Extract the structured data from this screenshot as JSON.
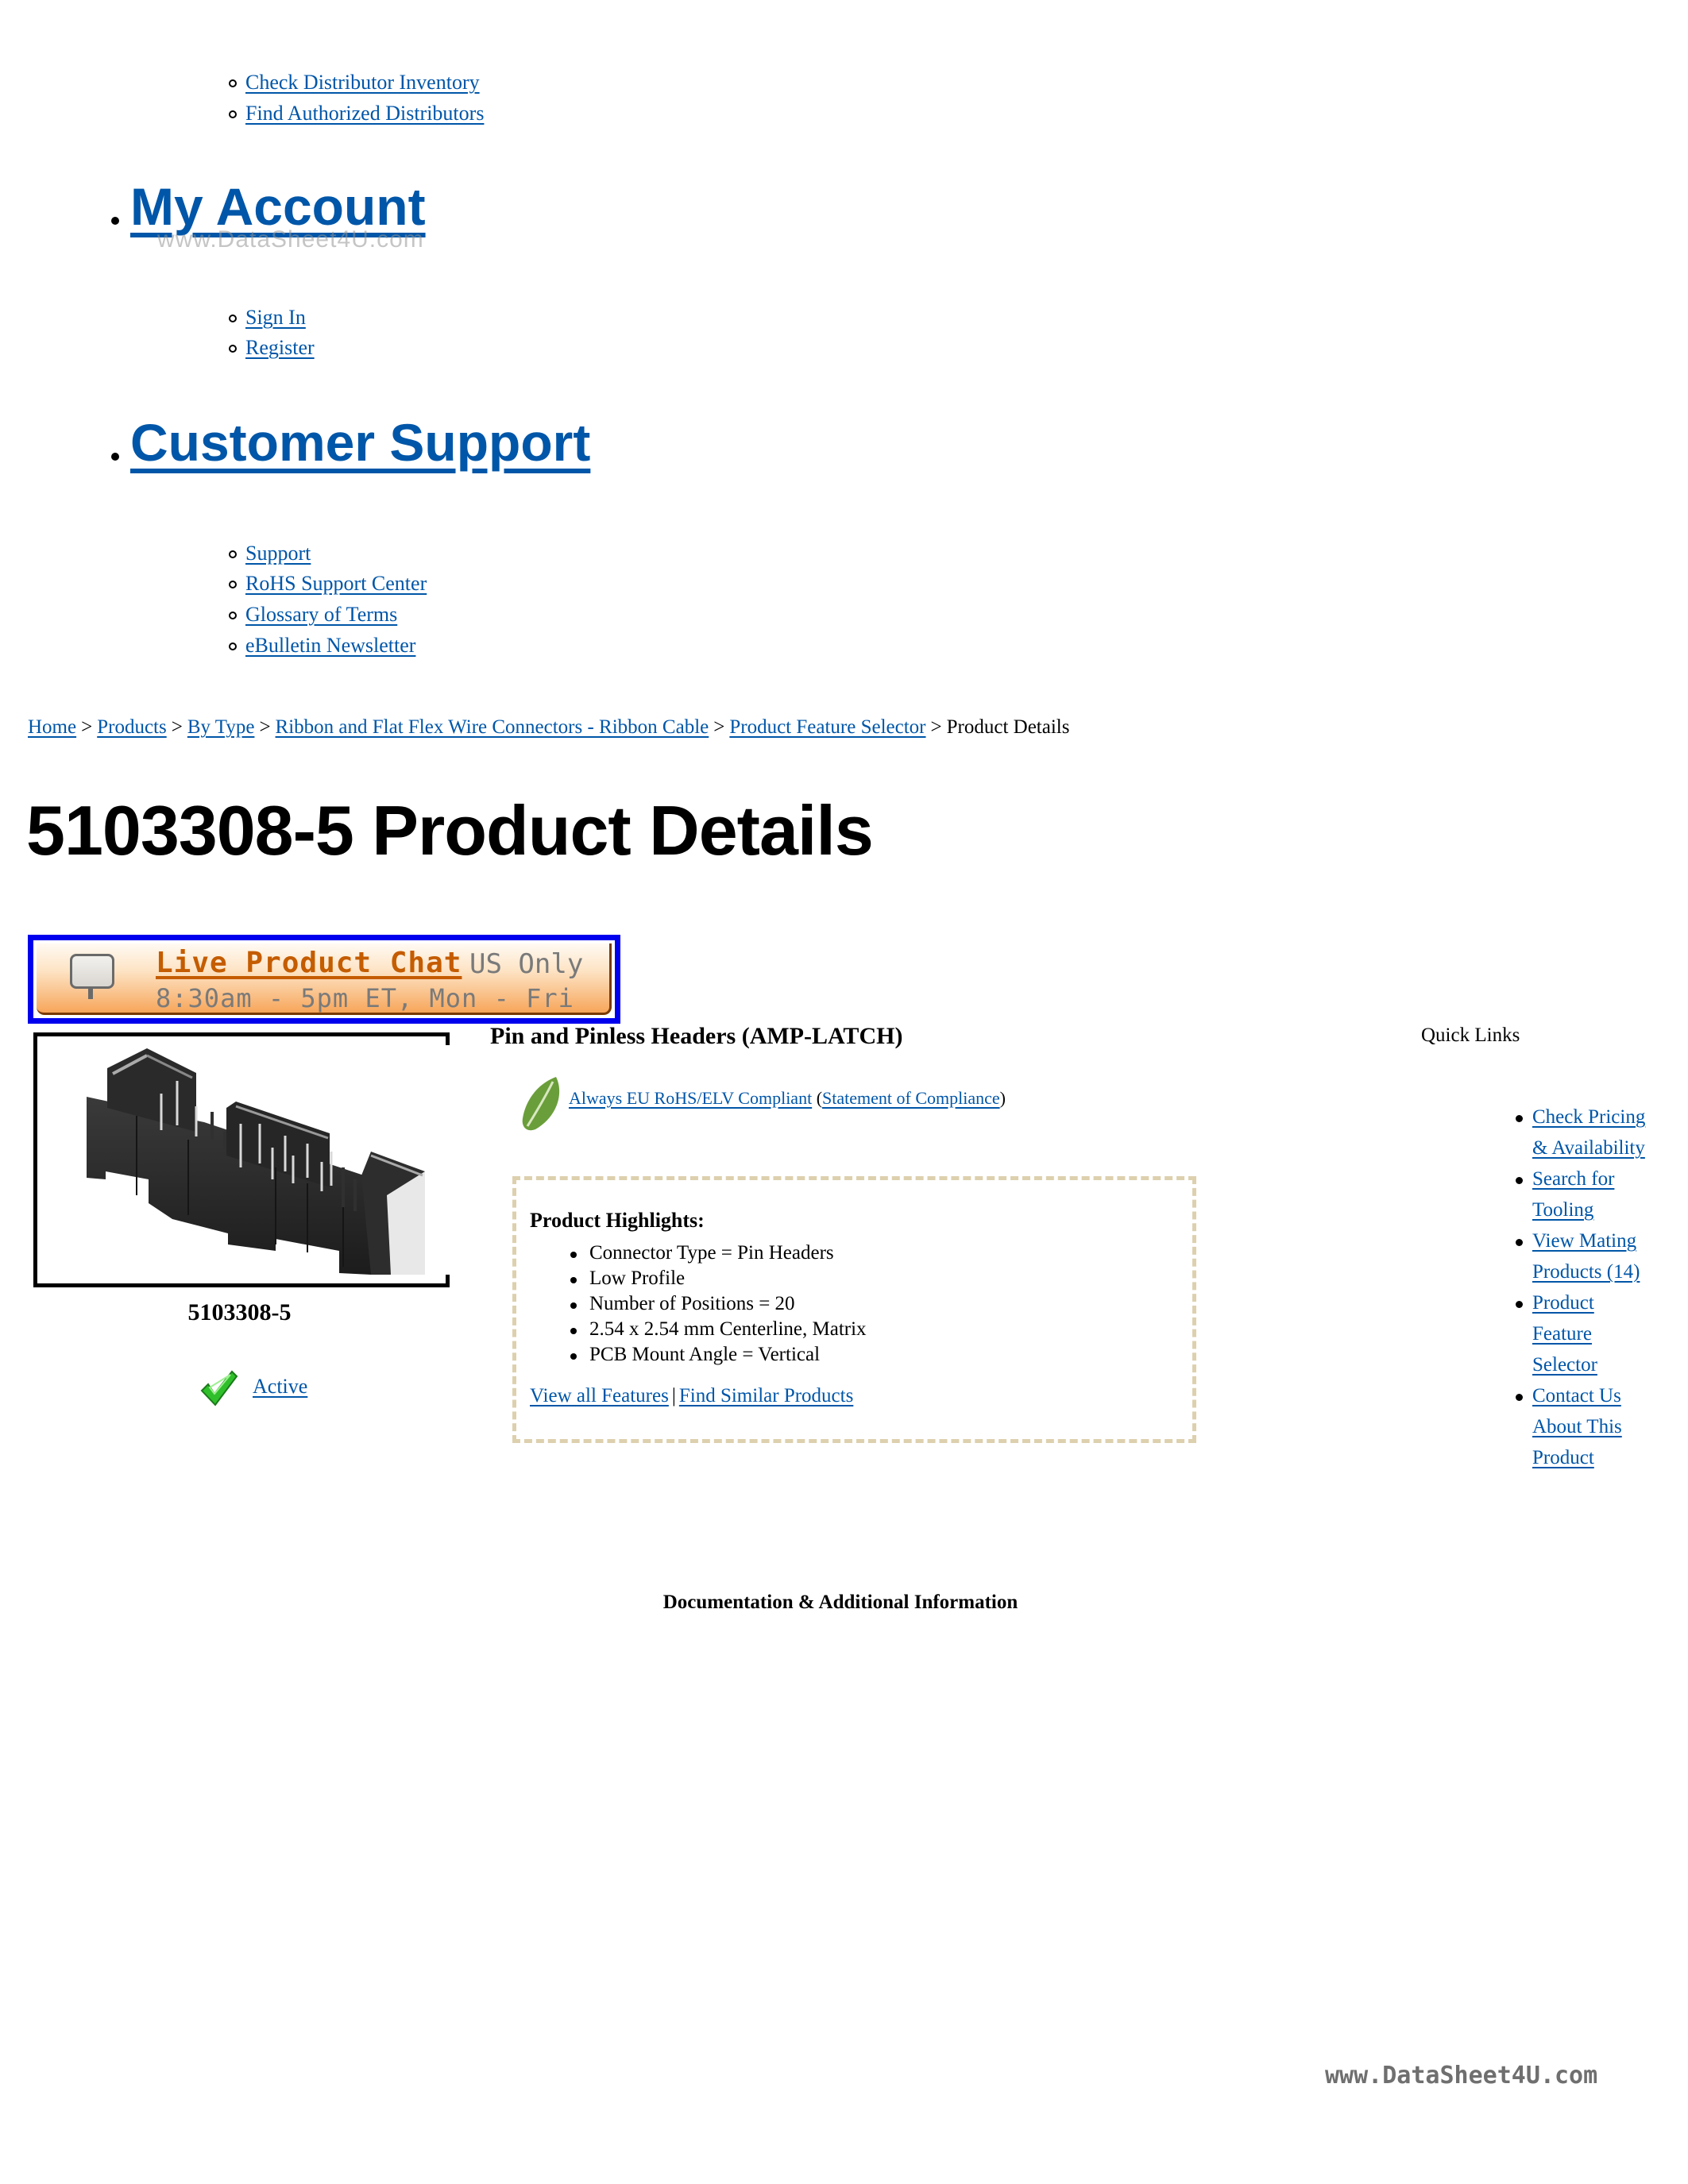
{
  "distributor_links": [
    {
      "label": "Check Distributor Inventory"
    },
    {
      "label": "Find Authorized Distributors"
    }
  ],
  "my_account": {
    "heading": "My Account",
    "links": [
      {
        "label": "Sign In"
      },
      {
        "label": "Register"
      }
    ]
  },
  "ghost_watermark": "www.DataSheet4U.com",
  "customer_support": {
    "heading": "Customer Support",
    "links": [
      {
        "label": "Support"
      },
      {
        "label": "RoHS Support Center"
      },
      {
        "label": "Glossary of Terms"
      },
      {
        "label": "eBulletin Newsletter"
      }
    ]
  },
  "breadcrumb": {
    "separator": ">",
    "items": [
      {
        "label": "Home"
      },
      {
        "label": "Products"
      },
      {
        "label": "By Type"
      },
      {
        "label": "Ribbon and Flat Flex Wire Connectors - Ribbon Cable"
      },
      {
        "label": "Product Feature Selector"
      }
    ],
    "current": "Product Details"
  },
  "page_title": "5103308-5 Product Details",
  "chat_banner": {
    "title": "Live Product Chat",
    "region": "US Only",
    "hours": "8:30am - 5pm ET, Mon - Fri",
    "icon": "speech-bubble-icon"
  },
  "product": {
    "part_number": "5103308-5",
    "image_alt": "pin header connector photo",
    "status": "Active",
    "status_icon": "green-checkmark-icon",
    "type": "Pin and Pinless Headers (AMP-LATCH)",
    "rohs": {
      "icon": "green-leaf-icon",
      "compliance_label": "Always EU RoHS/ELV Compliant",
      "open_paren": "(",
      "statement_label": "Statement of Compliance",
      "close_paren": ")"
    }
  },
  "highlights": {
    "title": "Product Highlights:",
    "items": [
      "Connector Type = Pin Headers",
      "Low Profile",
      "Number of Positions = 20",
      "2.54 x 2.54 mm Centerline, Matrix",
      "PCB Mount Angle = Vertical"
    ],
    "view_all_label": "View all Features",
    "divider": "|",
    "find_similar_label": "Find Similar Products"
  },
  "quick_links": {
    "title": "Quick Links",
    "items": [
      {
        "label": "Check Pricing & Availability"
      },
      {
        "label": "Search for Tooling"
      },
      {
        "label": "View Mating Products (14)"
      },
      {
        "label": "Product Feature Selector"
      },
      {
        "label": "Contact Us About This Product"
      }
    ]
  },
  "documentation_heading": "Documentation & Additional Information",
  "footer_watermark": "www.DataSheet4U.com",
  "colors": {
    "link": "#0056a8",
    "chat_border": "#0000ee",
    "chat_title": "#c45c00",
    "dashed_border": "#ddd0ae"
  }
}
